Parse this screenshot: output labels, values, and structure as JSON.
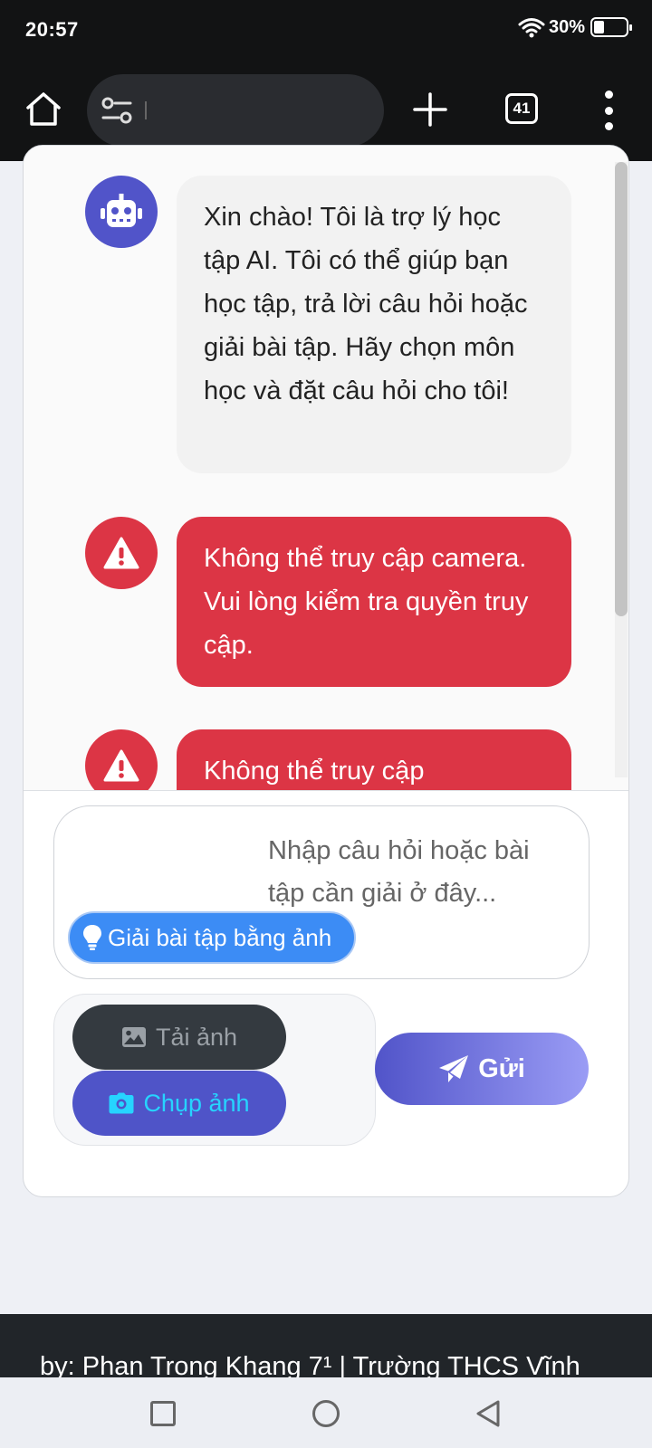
{
  "status_bar": {
    "time": "20:57",
    "battery": "30%"
  },
  "browser": {
    "tab_count": "41"
  },
  "messages": [
    {
      "type": "bot",
      "text": "Xin chào! Tôi là trợ lý học tập AI. Tôi có thể giúp bạn học tập, trả lời câu hỏi hoặc giải bài tập. Hãy chọn môn học và đặt câu hỏi cho tôi!"
    },
    {
      "type": "error",
      "text": "Không thể truy cập camera. Vui lòng kiểm tra quyền truy cập."
    },
    {
      "type": "error",
      "text": "Không thể truy cập"
    }
  ],
  "input": {
    "placeholder": "Nhập câu hỏi hoặc bài tập cần giải ở đây...",
    "hint_chip": "Giải bài tập bằng ảnh"
  },
  "buttons": {
    "upload": "Tải ảnh",
    "capture": "Chụp ảnh",
    "send": "Gửi"
  },
  "footer": {
    "text": "by: Phan Trong Khang 7¹ | Trường THCS Vĩnh"
  },
  "colors": {
    "primary": "#5154c9",
    "error": "#dc3545",
    "hint": "#3c8cf5",
    "capture_text": "#26d4ff"
  }
}
